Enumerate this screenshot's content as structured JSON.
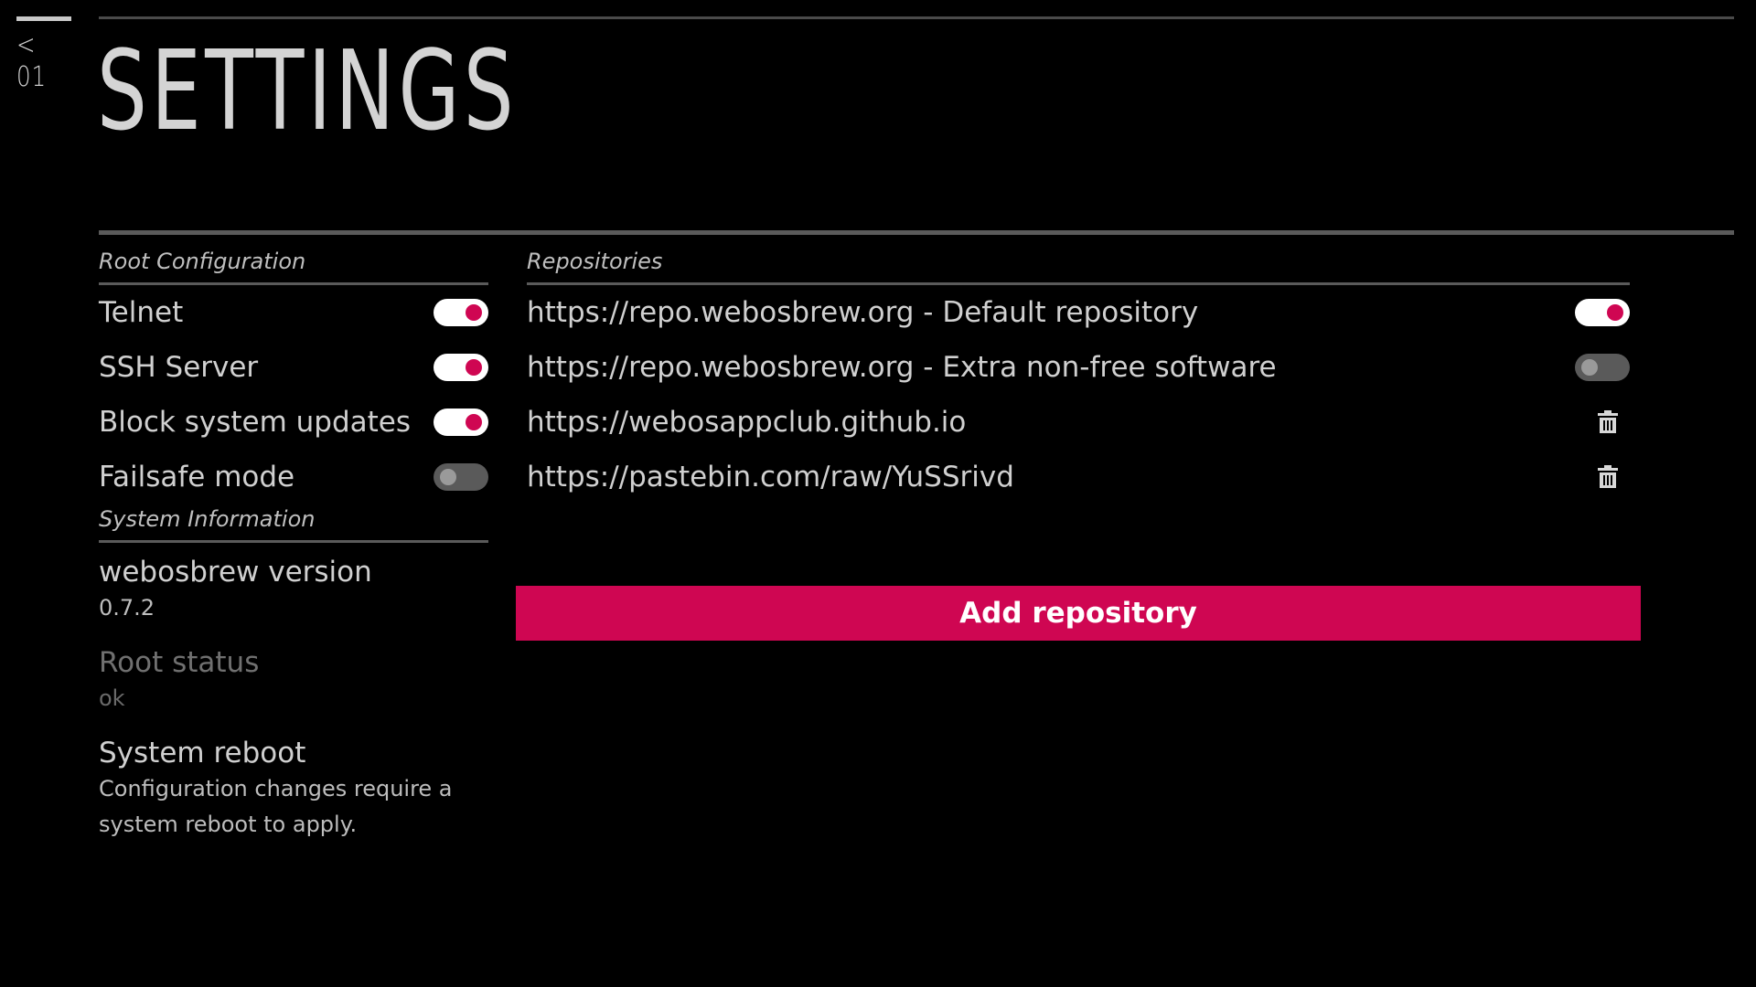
{
  "back": {
    "label": "< 01"
  },
  "title": "SETTINGS",
  "colors": {
    "accent": "#cf0652",
    "toggle_on_track": "#ffffff",
    "toggle_off_track": "#5a5a5a"
  },
  "root_config": {
    "heading": "Root Configuration",
    "items": [
      {
        "label": "Telnet",
        "enabled": true
      },
      {
        "label": "SSH Server",
        "enabled": true
      },
      {
        "label": "Block system updates",
        "enabled": true
      },
      {
        "label": "Failsafe mode",
        "enabled": false
      }
    ]
  },
  "system_info": {
    "heading": "System Information",
    "version": {
      "title": "webosbrew version",
      "value": "0.7.2"
    },
    "root_status": {
      "title": "Root status",
      "value": "ok"
    },
    "reboot": {
      "title": "System reboot",
      "value": "Configuration changes require a system reboot to apply."
    }
  },
  "repositories": {
    "heading": "Repositories",
    "items": [
      {
        "label": "https://repo.webosbrew.org - Default repository",
        "control": "toggle",
        "enabled": true
      },
      {
        "label": "https://repo.webosbrew.org - Extra non-free software",
        "control": "toggle",
        "enabled": false
      },
      {
        "label": "https://webosappclub.github.io",
        "control": "trash-icon"
      },
      {
        "label": "https://pastebin.com/raw/YuSSrivd",
        "control": "trash-icon"
      }
    ],
    "add_label": "Add repository"
  }
}
